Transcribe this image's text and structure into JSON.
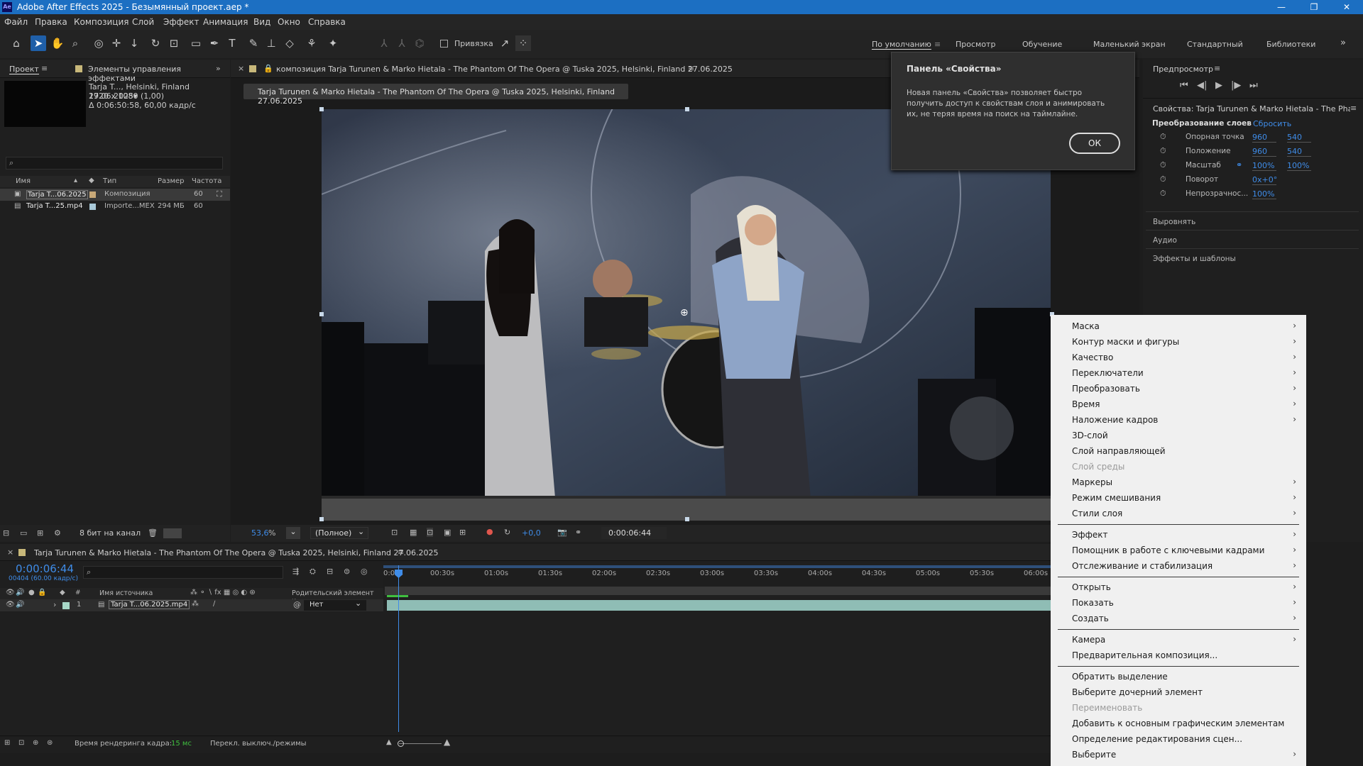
{
  "window": {
    "app_icon": "Ae",
    "title": "Adobe After Effects 2025 - Безымянный проект.aep *",
    "min": "—",
    "max": "❐",
    "close": "✕"
  },
  "menu": [
    "Файл",
    "Правка",
    "Композиция",
    "Слой",
    "Эффект",
    "Анимация",
    "Вид",
    "Окно",
    "Справка"
  ],
  "toolbar": {
    "snapping": "Привязка",
    "workspaces": [
      "По умолчанию",
      "Просмотр",
      "Обучение",
      "Маленький экран",
      "Стандартный",
      "Библиотеки"
    ],
    "more": "»"
  },
  "project": {
    "tab_project": "Проект",
    "tab_effects": "Элементы управления эффектами",
    "item_name": "Tarja T..., Helsinki, Finland 27.06.2025▾",
    "item_size": "1920 x 1080 (1,00)",
    "item_duration": "Δ 0:06:50:58, 60,00 кадр/с",
    "search_placeholder": "",
    "columns": [
      "Имя",
      "Тип",
      "Размер",
      "Частота ..."
    ],
    "rows": [
      {
        "name": "Tarja T...06.2025",
        "type": "Композиция",
        "size": "",
        "fps": "60"
      },
      {
        "name": "Tarja T...25.mp4",
        "type": "Importe...MEX",
        "size": "294 МБ",
        "fps": "60"
      }
    ],
    "bit_depth": "8 бит на канал"
  },
  "comp": {
    "tab": "композиция Tarja Turunen & Marko Hietala - The Phantom Of The Opera @ Tuska 2025, Helsinki, Finland 27.06.2025",
    "breadcrumb": "Tarja Turunen & Marko Hietala - The Phantom Of The Opera @ Tuska 2025, Helsinki, Finland 27.06.2025",
    "zoom": "53,6",
    "zoom_unit": "%",
    "quality": "(Полное)",
    "exposure": "+0,0",
    "timecode": "0:00:06:44"
  },
  "popup": {
    "title": "Панель «Свойства»",
    "body": "Новая панель «Свойства» позволяет быстро получить доступ к свойствам слоя и анимировать их, не теряя время на поиск на таймлайне.",
    "ok": "ОК"
  },
  "preview": {
    "title": "Предпросмотр"
  },
  "properties": {
    "title": "Свойства: Tarja Turunen & Marko Hietala - The Phantom",
    "section": "Преобразование слоев",
    "reset": "Сбросить",
    "rows": [
      {
        "label": "Опорная точка",
        "v1": "960",
        "v2": "540"
      },
      {
        "label": "Положение",
        "v1": "960",
        "v2": "540"
      },
      {
        "label": "Масштаб",
        "v1": "100%",
        "v2": "100%"
      },
      {
        "label": "Поворот",
        "v1": "0x+0°",
        "v2": ""
      },
      {
        "label": "Непрозрачнос...",
        "v1": "100%",
        "v2": ""
      }
    ],
    "collapsed": [
      "Выровнять",
      "Аудио",
      "Эффекты и шаблоны"
    ]
  },
  "timeline": {
    "tab": "Tarja Turunen & Marko Hietala - The Phantom Of The Opera @ Tuska 2025, Helsinki, Finland 27.06.2025",
    "timecode": "0:00:06:44",
    "frame_info": "00404 (60.00 кадр/с)",
    "col_source": "Имя источника",
    "col_parent": "Родительский элемент и...",
    "layer_num": "1",
    "layer_name": "Tarja T...06.2025.mp4",
    "parent_value": "Нет",
    "ruler": [
      "0:00s",
      "00:30s",
      "01:00s",
      "01:30s",
      "02:00s",
      "02:30s",
      "03:00s",
      "03:30s",
      "04:00s",
      "04:30s",
      "05:00s",
      "05:30s",
      "06:00s"
    ]
  },
  "status": {
    "render_label": "Время рендеринга кадра:",
    "render_value": "15 мс",
    "toggle": "Перекл. выключ./режимы"
  },
  "context_menu": [
    {
      "label": "Маска",
      "arrow": true
    },
    {
      "label": "Контур маски и фигуры",
      "arrow": true
    },
    {
      "label": "Качество",
      "arrow": true
    },
    {
      "label": "Переключатели",
      "arrow": true
    },
    {
      "label": "Преобразовать",
      "arrow": true
    },
    {
      "label": "Время",
      "arrow": true
    },
    {
      "label": "Наложение кадров",
      "arrow": true
    },
    {
      "label": "3D-слой",
      "arrow": false
    },
    {
      "label": "Слой направляющей",
      "arrow": false
    },
    {
      "label": "Слой среды",
      "arrow": false,
      "disabled": true
    },
    {
      "label": "Маркеры",
      "arrow": true
    },
    {
      "label": "Режим смешивания",
      "arrow": true
    },
    {
      "label": "Стили слоя",
      "arrow": true
    },
    {
      "sep": true
    },
    {
      "label": "Эффект",
      "arrow": true
    },
    {
      "label": "Помощник в работе с ключевыми кадрами",
      "arrow": true
    },
    {
      "label": "Отслеживание и стабилизация",
      "arrow": true
    },
    {
      "sep": true
    },
    {
      "label": "Открыть",
      "arrow": true
    },
    {
      "label": "Показать",
      "arrow": true
    },
    {
      "label": "Создать",
      "arrow": true
    },
    {
      "sep": true
    },
    {
      "label": "Камера",
      "arrow": true
    },
    {
      "label": "Предварительная композиция...",
      "arrow": false
    },
    {
      "sep": true
    },
    {
      "label": "Обратить выделение",
      "arrow": false
    },
    {
      "label": "Выберите дочерний элемент",
      "arrow": false
    },
    {
      "label": "Переименовать",
      "arrow": false,
      "disabled": true
    },
    {
      "label": "Добавить к основным графическим элементам",
      "arrow": false
    },
    {
      "label": "Определение редактирования сцен...",
      "arrow": false
    },
    {
      "label": "Выберите",
      "arrow": true
    }
  ]
}
